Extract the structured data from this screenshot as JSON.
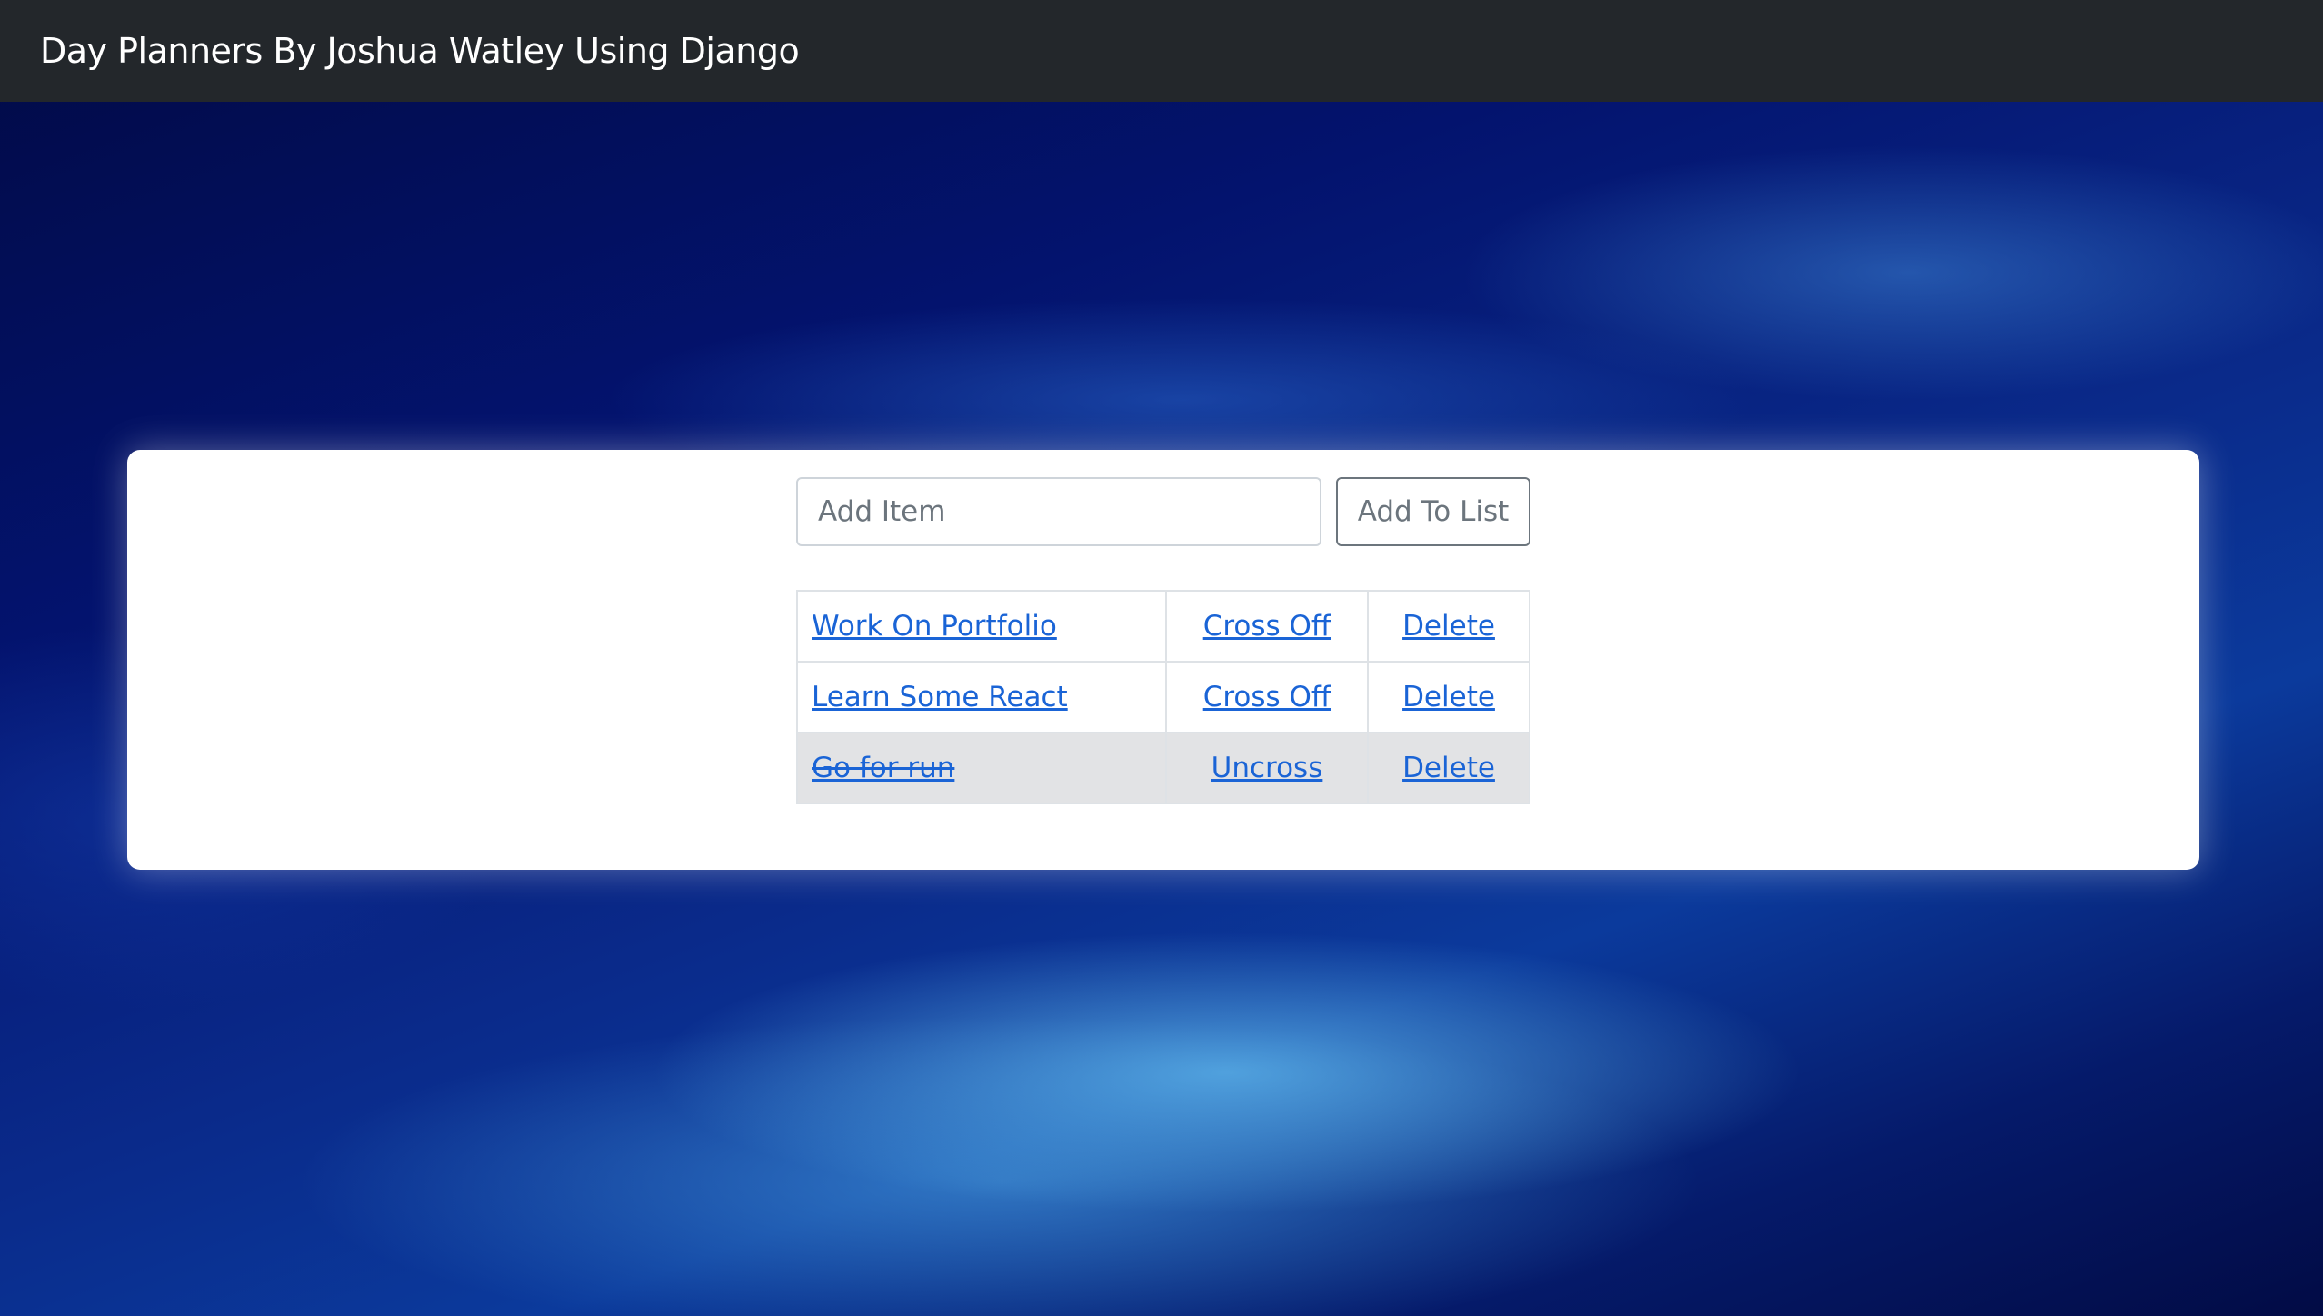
{
  "navbar": {
    "brand": "Day Planners By Joshua Watley Using Django"
  },
  "form": {
    "input_placeholder": "Add Item",
    "input_value": "",
    "submit_label": "Add To List"
  },
  "items": [
    {
      "text": "Work On Portfolio",
      "toggle_label": "Cross Off",
      "delete_label": "Delete",
      "completed": false
    },
    {
      "text": "Learn Some React",
      "toggle_label": "Cross Off",
      "delete_label": "Delete",
      "completed": false
    },
    {
      "text": "Go for run",
      "toggle_label": "Uncross",
      "delete_label": "Delete",
      "completed": true
    }
  ],
  "colors": {
    "navbar_bg": "#23272b",
    "link": "#1a64d6",
    "completed_row_bg": "#e2e3e5"
  }
}
